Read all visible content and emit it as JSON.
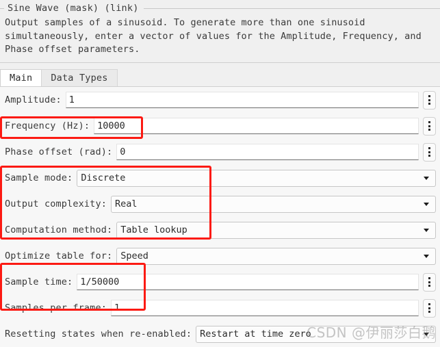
{
  "dialog": {
    "group_title": "Sine Wave (mask) (link)",
    "description": "Output samples of a sinusoid.  To generate more than one sinusoid\nsimultaneously, enter a vector of values for the Amplitude, Frequency, and\nPhase offset parameters."
  },
  "tabs": [
    {
      "label": "Main",
      "active": true
    },
    {
      "label": "Data Types",
      "active": false
    }
  ],
  "rows": [
    {
      "label": "Amplitude:",
      "kind": "text",
      "value": "1"
    },
    {
      "label": "Frequency (Hz):",
      "kind": "text",
      "value": "10000"
    },
    {
      "label": "Phase offset (rad):",
      "kind": "text",
      "value": "0"
    },
    {
      "label": "Sample mode:",
      "kind": "combo",
      "value": "Discrete"
    },
    {
      "label": "Output complexity:",
      "kind": "combo",
      "value": "Real"
    },
    {
      "label": "Computation method:",
      "kind": "combo",
      "value": "Table lookup"
    },
    {
      "label": "Optimize table for:",
      "kind": "combo",
      "value": "Speed"
    },
    {
      "label": "Sample time:",
      "kind": "text",
      "value": "1/50000"
    },
    {
      "label": "Samples per frame:",
      "kind": "text",
      "value": "1"
    },
    {
      "label": "Resetting states when re-enabled:",
      "kind": "combo",
      "value": "Restart at time zero"
    }
  ],
  "annotations": {
    "color": "#fc1a13",
    "boxes": [
      {
        "name": "frequency-highlight",
        "target": "Frequency (Hz)"
      },
      {
        "name": "modes-highlight",
        "target": "Sample mode / Output complexity / Computation method"
      },
      {
        "name": "sampling-highlight",
        "target": "Sample time / Samples per frame"
      }
    ]
  },
  "watermark": {
    "text": "CSDN @伊丽莎白鹅"
  }
}
